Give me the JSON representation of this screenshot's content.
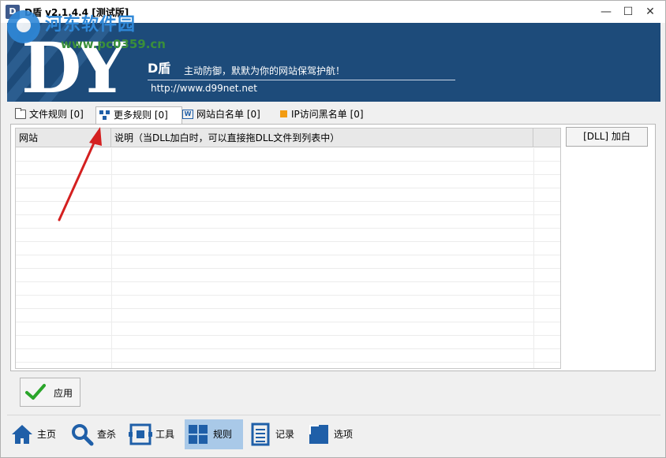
{
  "window": {
    "title": "D盾 v2.1.4.4 [测试版]",
    "app_icon": "D",
    "controls": {
      "minimize": "—",
      "maximize": "☐",
      "close": "✕"
    }
  },
  "watermark": {
    "text": "河东软件园",
    "url": "www.pc0359.cn"
  },
  "banner": {
    "logo": "DY",
    "brand": "D盾",
    "slogan": "主动防御，默默为你的网站保驾护航！",
    "url": "http://www.d99net.net"
  },
  "tabs": [
    {
      "label": "文件规则 [0]",
      "icon": "folder-icon"
    },
    {
      "label": "更多规则 [0]",
      "icon": "more-rules-icon",
      "active": true
    },
    {
      "label": "网站白名单 [0]",
      "icon": "www-icon"
    },
    {
      "label": "IP访问黑名单 [0]",
      "icon": "ip-square-icon"
    }
  ],
  "grid": {
    "columns": [
      "网站",
      "说明（当DLL加白时，可以直接拖DLL文件到列表中）",
      ""
    ],
    "rows": []
  },
  "dll_button": "[DLL] 加白",
  "apply_button": "应用",
  "nav": [
    {
      "label": "主页",
      "icon": "home-icon"
    },
    {
      "label": "查杀",
      "icon": "search-icon"
    },
    {
      "label": "工具",
      "icon": "tools-icon"
    },
    {
      "label": "规则",
      "icon": "rules-icon",
      "active": true
    },
    {
      "label": "记录",
      "icon": "log-icon"
    },
    {
      "label": "选项",
      "icon": "options-icon"
    }
  ],
  "colors": {
    "banner_bg": "#1d4b7a",
    "active_nav": "#a9c9e8",
    "annotation_arrow": "#d42020",
    "icon_blue": "#1f5fa8"
  }
}
